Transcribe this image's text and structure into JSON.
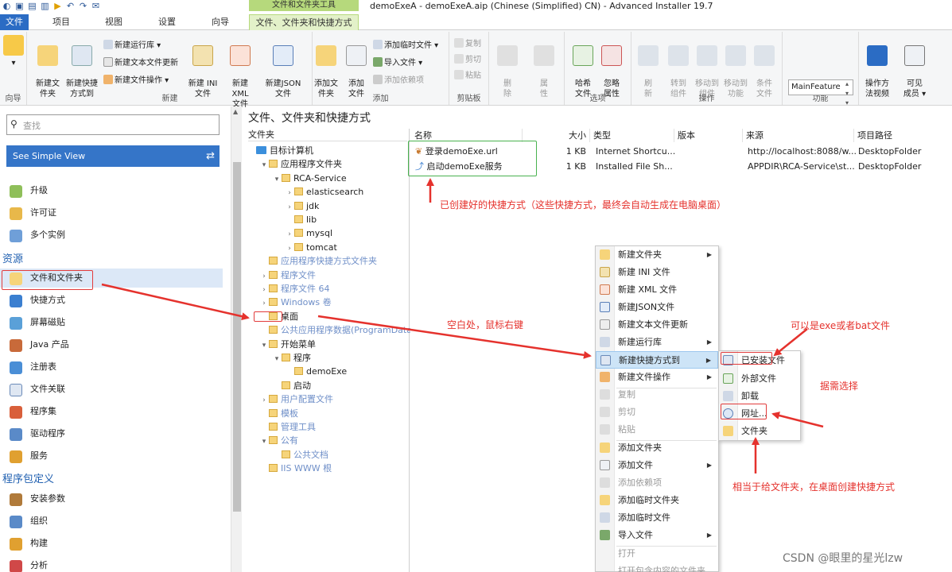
{
  "window": {
    "title": "demoExeA - demoExeA.aip (Chinese (Simplified) CN) - Advanced Installer 19.7",
    "context_tools_label": "文件和文件夹工具"
  },
  "tabs": [
    "文件",
    "项目",
    "视图",
    "设置",
    "向导",
    "文件、文件夹和快捷方式"
  ],
  "ribbon": {
    "groups": {
      "wizard": "向导",
      "new": "新建",
      "add": "添加",
      "clipboard": "剪贴板",
      "options": "选项",
      "operations": "操作",
      "feature": "功能"
    },
    "new_folder": "新建文\n件夹",
    "new_shortcut": "新建快捷\n方式到",
    "new_runtime": "新建运行库",
    "new_text_update": "新建文本文件更新",
    "new_file_op": "新建文件操作",
    "new_ini": "新建 INI\n文件",
    "new_xml": "新建 XML\n文件",
    "new_json": "新建JSON\n文件",
    "add_folder": "添加文\n件夹",
    "add_file": "添加\n文件",
    "add_temp_file": "添加临时文件",
    "import_file": "导入文件",
    "add_dependency": "添加依赖项",
    "copy": "复制",
    "cut": "剪切",
    "paste": "粘贴",
    "delete": "删\n除",
    "properties": "属\n性",
    "hash_file": "哈希\n文件",
    "ignore_attr": "忽略\n属性",
    "refresh": "刷\n新",
    "move_to_component": "转到\n组件",
    "move_to_component2": "移动到\n组件",
    "move_to_feature": "移动到\n功能",
    "conditional_file": "条件\n文件",
    "feature_combo": "MainFeature",
    "video": "操作方\n法视频",
    "visible_members": "可见\n成员"
  },
  "left_nav": {
    "search_placeholder": "查找",
    "simple_view": "See Simple View",
    "items_top": [
      "升级",
      "许可证",
      "多个实例"
    ],
    "section_resources": "资源",
    "resources": [
      "文件和文件夹",
      "快捷方式",
      "屏幕磁贴",
      "Java 产品",
      "注册表",
      "文件关联",
      "程序集",
      "驱动程序",
      "服务"
    ],
    "section_package": "程序包定义",
    "package": [
      "安装参数",
      "组织",
      "构建",
      "分析"
    ]
  },
  "main": {
    "title": "文件、文件夹和快捷方式",
    "tree_header": "文件夹",
    "tree": [
      {
        "label": "目标计算机",
        "indent": 0,
        "exp": "",
        "kind": "pc"
      },
      {
        "label": "应用程序文件夹",
        "indent": 1,
        "exp": "▾",
        "kind": "folder"
      },
      {
        "label": "RCA-Service",
        "indent": 2,
        "exp": "▾",
        "kind": "folder"
      },
      {
        "label": "elasticsearch",
        "indent": 3,
        "exp": "›",
        "kind": "folder"
      },
      {
        "label": "jdk",
        "indent": 3,
        "exp": "›",
        "kind": "folder"
      },
      {
        "label": "lib",
        "indent": 3,
        "exp": "",
        "kind": "folder"
      },
      {
        "label": "mysql",
        "indent": 3,
        "exp": "›",
        "kind": "folder"
      },
      {
        "label": "tomcat",
        "indent": 3,
        "exp": "›",
        "kind": "folder"
      },
      {
        "label": "应用程序快捷方式文件夹",
        "indent": 1,
        "exp": "",
        "kind": "folder",
        "dim": true
      },
      {
        "label": "程序文件",
        "indent": 1,
        "exp": "›",
        "kind": "folder",
        "dim": true
      },
      {
        "label": "程序文件 64",
        "indent": 1,
        "exp": "›",
        "kind": "folder",
        "dim": true
      },
      {
        "label": "Windows 卷",
        "indent": 1,
        "exp": "›",
        "kind": "folder",
        "dim": true
      },
      {
        "label": "桌面",
        "indent": 1,
        "exp": "",
        "kind": "folder"
      },
      {
        "label": "公共应用程序数据(ProgramData)",
        "indent": 1,
        "exp": "",
        "kind": "folder",
        "dim": true
      },
      {
        "label": "开始菜单",
        "indent": 1,
        "exp": "▾",
        "kind": "folder"
      },
      {
        "label": "程序",
        "indent": 2,
        "exp": "▾",
        "kind": "folder"
      },
      {
        "label": "demoExe",
        "indent": 3,
        "exp": "",
        "kind": "folder"
      },
      {
        "label": "启动",
        "indent": 2,
        "exp": "",
        "kind": "folder"
      },
      {
        "label": "用户配置文件",
        "indent": 1,
        "exp": "›",
        "kind": "folder",
        "dim": true
      },
      {
        "label": "模板",
        "indent": 1,
        "exp": "",
        "kind": "folder",
        "dim": true
      },
      {
        "label": "管理工具",
        "indent": 1,
        "exp": "",
        "kind": "folder",
        "dim": true
      },
      {
        "label": "公有",
        "indent": 1,
        "exp": "▾",
        "kind": "folder",
        "dim": true
      },
      {
        "label": "公共文档",
        "indent": 2,
        "exp": "",
        "kind": "folder",
        "dim": true
      },
      {
        "label": "IIS WWW 根",
        "indent": 1,
        "exp": "",
        "kind": "folder",
        "dim": true
      }
    ],
    "columns": [
      "名称",
      "大小",
      "类型",
      "版本",
      "来源",
      "项目路径"
    ],
    "rows": [
      {
        "name": "登录demoExe.url",
        "size": "1 KB",
        "type": "Internet Shortcu...",
        "version": "",
        "source": "http://localhost:8088/w...",
        "path": "DesktopFolder"
      },
      {
        "name": "启动demoExe服务",
        "size": "1 KB",
        "type": "Installed File Sh...",
        "version": "",
        "source": "APPDIR\\RCA-Service\\st...",
        "path": "DesktopFolder"
      }
    ]
  },
  "context_menu": {
    "items": [
      "新建文件夹",
      "新建 INI 文件",
      "新建 XML 文件",
      "新建JSON文件",
      "新建文本文件更新",
      "新建运行库",
      "新建快捷方式到",
      "新建文件操作",
      "复制",
      "剪切",
      "粘贴",
      "添加文件夹",
      "添加文件",
      "添加依赖项",
      "添加临时文件夹",
      "添加临时文件",
      "导入文件",
      "打开",
      "打开包含内容的文件夹"
    ],
    "submenu": [
      "已安装文件",
      "外部文件",
      "卸载",
      "网址...",
      "文件夹"
    ]
  },
  "annotations": {
    "created_shortcuts": "已创建好的快捷方式（这些快捷方式，最终会自动生成在电脑桌面）",
    "right_click": "空白处，鼠标右键",
    "exe_or_bat": "可以是exe或者bat文件",
    "as_needed": "据需选择",
    "folder_shortcut": "相当于给文件夹，在桌面创建快捷方式",
    "watermark": "CSDN @眼里的星光lzw"
  },
  "colors": {
    "accent": "#2b6cc4",
    "annotation_red": "#e5322d",
    "context_green": "#b6d97c"
  }
}
